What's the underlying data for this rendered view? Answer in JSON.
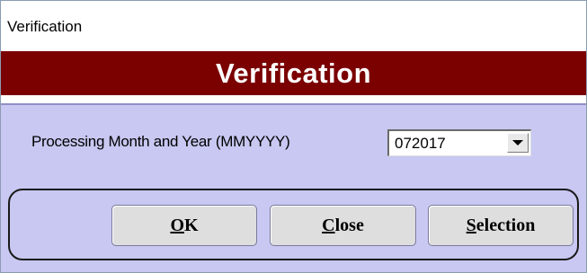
{
  "window": {
    "title": "Verification"
  },
  "header": {
    "title": "Verification",
    "band_color": "#7b0000"
  },
  "form": {
    "processing_label": "Processing Month and Year (MMYYYY)",
    "processing_value": "072017",
    "background_color": "#c8c8f2"
  },
  "buttons": {
    "ok": {
      "accel": "O",
      "rest": "K"
    },
    "close": {
      "accel": "C",
      "rest": "lose"
    },
    "selection": {
      "accel": "S",
      "rest": "election"
    }
  },
  "icons": {
    "combo_dropdown": "chevron-down-icon"
  }
}
